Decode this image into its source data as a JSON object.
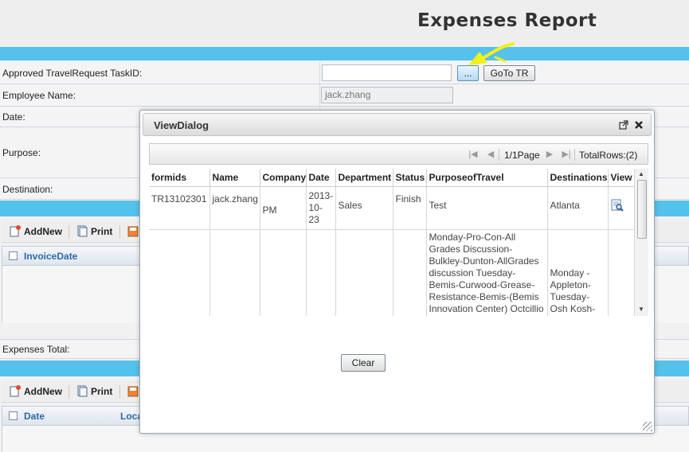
{
  "page": {
    "title": "Expenses Report"
  },
  "form": {
    "taskid_label": "Approved TravelRequest TaskID:",
    "browse_button": "...",
    "goto_button": "GoTo TR",
    "employee_label": "Employee Name:",
    "employee_value": "jack.zhang",
    "date_label": "Date:",
    "purpose_label": "Purpose:",
    "destination_label": "Destination:",
    "expenses_total_label": "Expenses Total:"
  },
  "toolbar1": {
    "addnew": "AddNew",
    "print": "Print"
  },
  "grid1": {
    "col1": "InvoiceDate"
  },
  "toolbar2": {
    "addnew": "AddNew",
    "print": "Print"
  },
  "grid2": {
    "col1": "Date",
    "col2": "Loca"
  },
  "dialog": {
    "title": "ViewDialog",
    "pager": {
      "page": "1/1Page",
      "total": "TotalRows:(2)"
    },
    "columns": [
      "formids",
      "Name",
      "Company",
      "Date",
      "Department",
      "Status",
      "PurposeofTravel",
      "Destinations",
      "View"
    ],
    "rows": [
      {
        "formids": "TR13102301",
        "name": "jack.zhang",
        "company": "PM",
        "date": "2013-10-23",
        "department": "Sales",
        "status": "Finish",
        "purpose": "Test",
        "destinations": "Atlanta",
        "view_icon": "view-details-icon"
      },
      {
        "formids": "",
        "name": "",
        "company": "",
        "date": "",
        "department": "",
        "status": "",
        "purpose": "Monday-Pro-Con-All Grades Discussion-Bulkley-Dunton-AllGrades discussion Tuesday-Bemis-Curwood-Grease-Resistance-Bemis-(Bemis Innovation Center) Octcillio Berbert VP of R&D",
        "destinations": "Monday - Appleton-Tuesday-Osh Kosh-Neenah-",
        "view_icon": ""
      }
    ],
    "clear_button": "Clear"
  },
  "colors": {
    "accent_bar": "#55c2ec",
    "grid_header_text": "#2c6aa8",
    "annotation_arrow": "#f5ef1a"
  }
}
